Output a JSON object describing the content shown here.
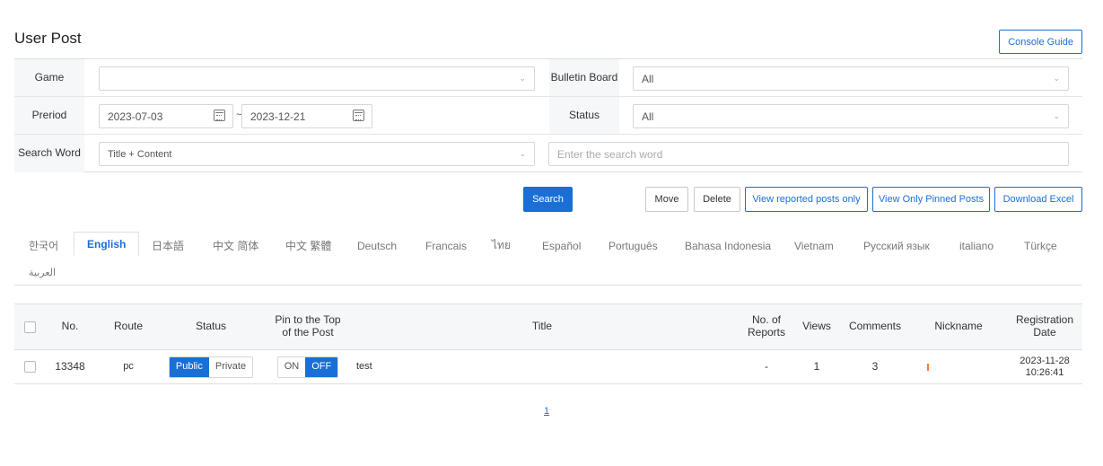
{
  "page": {
    "title": "User Post",
    "console_guide": "Console Guide"
  },
  "filters": {
    "game_label": "Game",
    "game_value": "",
    "board_label": "Bulletin Board",
    "board_value": "All",
    "period_label": "Preriod",
    "period_start": "2023-07-03",
    "period_sep": "~",
    "period_end": "2023-12-21",
    "status_label": "Status",
    "status_value": "All",
    "search_label": "Search Word",
    "search_type": "Title + Content",
    "search_placeholder": "Enter the search word"
  },
  "actions": {
    "search": "Search",
    "move": "Move",
    "delete": "Delete",
    "reported": "View reported posts only",
    "pinned": "View Only Pinned Posts",
    "excel": "Download Excel"
  },
  "languages": [
    "한국어",
    "English",
    "日本語",
    "中文 简体",
    "中文 繁體",
    "Deutsch",
    "Francais",
    "ไทย",
    "Español",
    "Português",
    "Bahasa Indonesia",
    "Vietnam",
    "Русский язык",
    "italiano",
    "Türkçe",
    "العربية"
  ],
  "active_language": "English",
  "table": {
    "headers": {
      "no": "No.",
      "route": "Route",
      "status": "Status",
      "pin": "Pin to the Top of the Post",
      "title": "Title",
      "reports": "No. of Reports",
      "views": "Views",
      "comments": "Comments",
      "nickname": "Nickname",
      "date": "Registration Date"
    },
    "rows": [
      {
        "no": "13348",
        "route": "pc",
        "status_public": "Public",
        "status_private": "Private",
        "status_selected": "Public",
        "pin_on": "ON",
        "pin_off": "OFF",
        "pin_selected": "OFF",
        "title": "test",
        "reports": "-",
        "views": "1",
        "comments": "3",
        "nickname": "",
        "date": "2023-11-28 10:26:41"
      }
    ]
  },
  "pagination": {
    "current": "1"
  },
  "colors": {
    "accent": "#1a6fd6",
    "nickname_flag": "#ff7a2a"
  }
}
